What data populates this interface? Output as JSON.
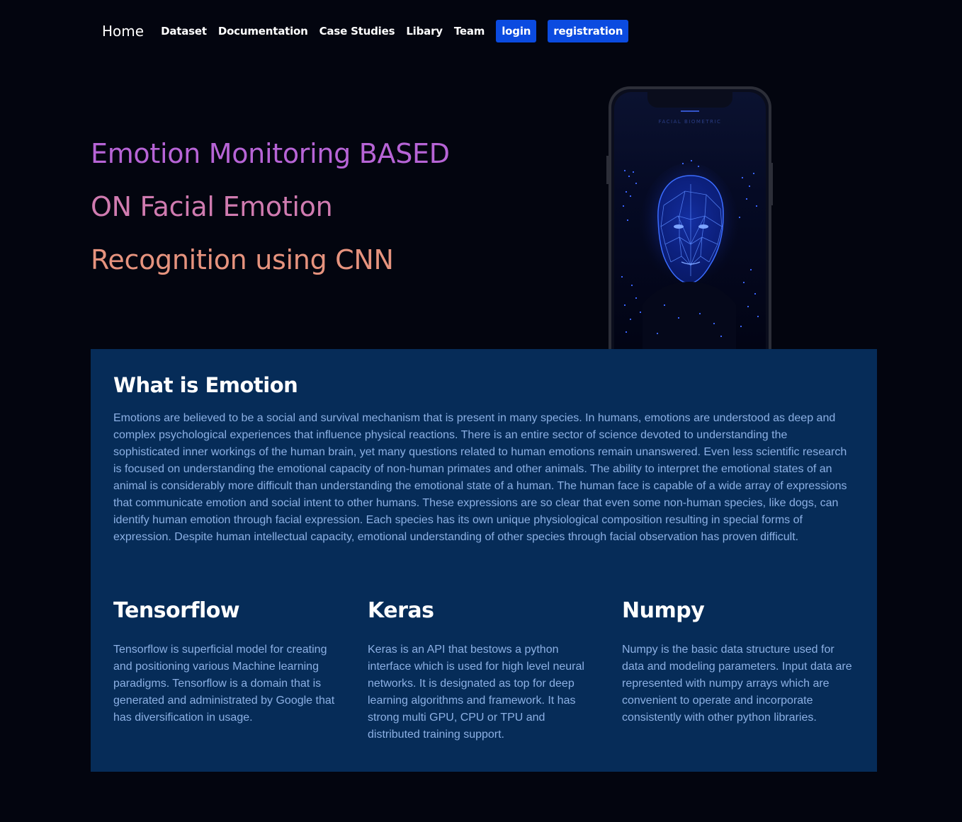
{
  "nav": {
    "home": "Home",
    "links": [
      "Dataset",
      "Documentation",
      "Case Studies",
      "Libary",
      "Team"
    ],
    "login": "login",
    "registration": "registration"
  },
  "hero": {
    "line1": "Emotion Monitoring BASED",
    "line2": "ON Facial Emotion",
    "line3": "Recognition using CNN",
    "phone_label": "FACIAL BIOMETRIC"
  },
  "about": {
    "title": "What is Emotion",
    "body": "Emotions are believed to be a social and survival mechanism that is present in many species. In humans, emotions are understood as deep and complex psychological experiences that influence physical reactions. There is an entire sector of science devoted to understanding the sophisticated inner workings of the human brain, yet many questions related to human emotions remain unanswered. Even less scientific research is focused on understanding the emotional capacity of non-human primates and other animals. The ability to interpret the emotional states of an animal is considerably more difficult than understanding the emotional state of a human. The human face is capable of a wide array of expressions that communicate emotion and social intent to other humans. These expressions are so clear that even some non-human species, like dogs, can identify human emotion through facial expression. Each species has its own unique physiological composition resulting in special forms of expression. Despite human intellectual capacity, emotional understanding of other species through facial observation has proven difficult."
  },
  "features": [
    {
      "title": "Tensorflow",
      "body": "Tensorflow is superficial model for creating and positioning various Machine learning paradigms. Tensorflow is a domain that is generated and administrated by Google that has diversification in usage."
    },
    {
      "title": "Keras",
      "body": "Keras is an API that bestows a python interface which is used for high level neural networks. It is designated as top for deep learning algorithms and framework. It has strong multi GPU, CPU or TPU and distributed training support."
    },
    {
      "title": "Numpy",
      "body": "Numpy is the basic data structure used for data and modeling parameters. Input data are represented with numpy arrays which are convenient to operate and incorporate consistently with other python libraries."
    }
  ],
  "colors": {
    "background": "#03050f",
    "panel": "#062c58",
    "button": "#0b4be0",
    "body_text": "#8cb0e4",
    "title_purple": "#b764d6",
    "title_pink": "#d07bb0",
    "title_peach": "#e6937e"
  }
}
